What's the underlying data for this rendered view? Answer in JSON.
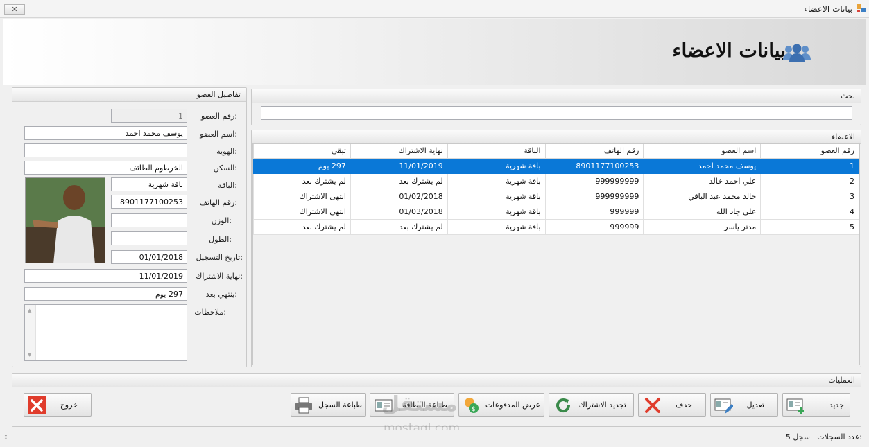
{
  "window": {
    "title": "بيانات الاعضاء",
    "close_label": "✕"
  },
  "header": {
    "title": "بيانات الاعضاء",
    "icon": "users-icon"
  },
  "details": {
    "group_title": "تفاصيل العضو",
    "fields": [
      {
        "label": "رقم العضو:",
        "value": "1"
      },
      {
        "label": "اسم العضو:",
        "value": "يوسف محمد احمد"
      },
      {
        "label": "الهوية:",
        "value": ""
      },
      {
        "label": "السكن:",
        "value": "الخرطوم الطائف"
      },
      {
        "label": "الباقة:",
        "value": "باقة شهرية"
      },
      {
        "label": "رقم الهاتف:",
        "value": "8901177100253"
      },
      {
        "label": "الوزن:",
        "value": ""
      },
      {
        "label": "الطول:",
        "value": ""
      },
      {
        "label": "تاريخ التسجيل:",
        "value": "01/01/2018"
      },
      {
        "label": "نهاية الاشتراك:",
        "value": "11/01/2019"
      },
      {
        "label": "ينتهي بعد:",
        "value": "297 يوم"
      },
      {
        "label": "ملاحظات:",
        "value": ""
      }
    ]
  },
  "search": {
    "group_title": "بحث",
    "value": ""
  },
  "members": {
    "group_title": "الاعضاء",
    "columns": [
      "رقم العضو",
      "اسم العضو",
      "رقم الهاتف",
      "الباقة",
      "نهاية الاشتراك",
      "تبقى"
    ],
    "rows": [
      [
        "1",
        "يوسف محمد احمد",
        "8901177100253",
        "باقة شهرية",
        "11/01/2019",
        "297 يوم"
      ],
      [
        "2",
        "علي احمد خالد",
        "999999999",
        "باقة شهرية",
        "لم يشترك بعد",
        "لم يشترك بعد"
      ],
      [
        "3",
        "خالد محمد عبد الباقي",
        "999999999",
        "باقة شهرية",
        "01/02/2018",
        "انتهى الاشتراك"
      ],
      [
        "4",
        "علي جاد الله",
        "999999",
        "باقة شهرية",
        "01/03/2018",
        "انتهى الاشتراك"
      ],
      [
        "5",
        "مدثر ياسر",
        "999999",
        "باقة شهرية",
        "لم يشترك بعد",
        "لم يشترك بعد"
      ]
    ],
    "selected_row": 0
  },
  "operations": {
    "group_title": "العمليات",
    "buttons": {
      "new": "جديد",
      "edit": "تعديل",
      "delete": "حذف",
      "renew": "تجديد الاشتراك",
      "payments": "عرض المدفوعات",
      "print_card": "طباعة البطاقة",
      "print_record": "طباعة السجل",
      "exit": "خروج"
    }
  },
  "status": {
    "records_label": "عدد السجلات:",
    "records_value": "5 سجل"
  },
  "watermark": {
    "text": "مستقل",
    "subtext": "mostaql.com"
  },
  "colors": {
    "selection": "#0a78d7",
    "delete_red": "#e03c2c",
    "accent_blue": "#3c7fc4"
  }
}
